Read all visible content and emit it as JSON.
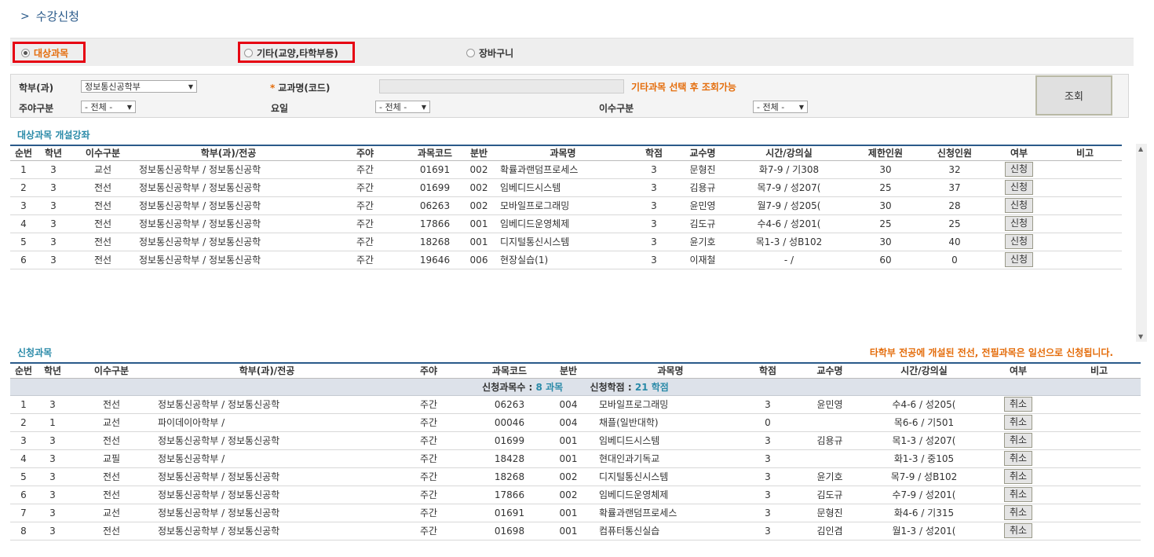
{
  "page": {
    "title": "수강신청"
  },
  "tabs": {
    "target": "대상과목",
    "other": "기타(교양,타학부등)",
    "cart": "장바구니"
  },
  "search": {
    "dept_label": "학부(과)",
    "dept_value": "정보통신공학부",
    "course_label": "교과명(코드)",
    "hint": "기타과목 선택 후 조회가능",
    "daynight_label": "주야구분",
    "daynight_value": "- 전체 -",
    "day_label": "요일",
    "day_value": "- 전체 -",
    "type_label": "이수구분",
    "type_value": "- 전체 -",
    "button": "조회"
  },
  "open_courses": {
    "title": "대상과목 개설강좌",
    "headers": [
      "순번",
      "학년",
      "이수구분",
      "학부(과)/전공",
      "주야",
      "과목코드",
      "분반",
      "과목명",
      "학점",
      "교수명",
      "시간/강의실",
      "제한인원",
      "신청인원",
      "여부",
      "비고"
    ],
    "rows": [
      [
        "1",
        "3",
        "교선",
        "정보통신공학부 / 정보통신공학",
        "주간",
        "01691",
        "002",
        "확률과랜덤프로세스",
        "3",
        "문형진",
        "화7-9 / 기308",
        "30",
        "32",
        "신청",
        ""
      ],
      [
        "2",
        "3",
        "전선",
        "정보통신공학부 / 정보통신공학",
        "주간",
        "01699",
        "002",
        "임베디드시스템",
        "3",
        "김용규",
        "목7-9 / 성207(",
        "25",
        "37",
        "신청",
        ""
      ],
      [
        "3",
        "3",
        "전선",
        "정보통신공학부 / 정보통신공학",
        "주간",
        "06263",
        "002",
        "모바일프로그래밍",
        "3",
        "윤민영",
        "월7-9 / 성205(",
        "30",
        "28",
        "신청",
        ""
      ],
      [
        "4",
        "3",
        "전선",
        "정보통신공학부 / 정보통신공학",
        "주간",
        "17866",
        "001",
        "임베디드운영체제",
        "3",
        "김도규",
        "수4-6 / 성201(",
        "25",
        "25",
        "신청",
        ""
      ],
      [
        "5",
        "3",
        "전선",
        "정보통신공학부 / 정보통신공학",
        "주간",
        "18268",
        "001",
        "디지털통신시스템",
        "3",
        "윤기호",
        "목1-3 / 성B102",
        "30",
        "40",
        "신청",
        ""
      ],
      [
        "6",
        "3",
        "전선",
        "정보통신공학부 / 정보통신공학",
        "주간",
        "19646",
        "006",
        "현장실습(1)",
        "3",
        "이재철",
        "- /",
        "60",
        "0",
        "신청",
        ""
      ]
    ]
  },
  "applied": {
    "title": "신청과목",
    "notice": "타학부 전공에 개설된 전선, 전필과목은 일선으로 신청됩니다.",
    "headers": [
      "순번",
      "학년",
      "이수구분",
      "학부(과)/전공",
      "주야",
      "과목코드",
      "분반",
      "과목명",
      "학점",
      "교수명",
      "시간/강의실",
      "여부",
      "비고"
    ],
    "summary": {
      "count_label": "신청과목수 :",
      "count_value": "8 과목",
      "credit_label": "신청학점 :",
      "credit_value": "21 학점"
    },
    "rows": [
      [
        "1",
        "3",
        "전선",
        "정보통신공학부 / 정보통신공학",
        "주간",
        "06263",
        "004",
        "모바일프로그래밍",
        "3",
        "윤민영",
        "수4-6 / 성205(",
        "취소",
        ""
      ],
      [
        "2",
        "1",
        "교선",
        "파이데이아학부 /",
        "주간",
        "00046",
        "004",
        "채플(일반대학)",
        "0",
        "",
        "목6-6 / 기501",
        "취소",
        ""
      ],
      [
        "3",
        "3",
        "전선",
        "정보통신공학부 / 정보통신공학",
        "주간",
        "01699",
        "001",
        "임베디드시스템",
        "3",
        "김용규",
        "목1-3 / 성207(",
        "취소",
        ""
      ],
      [
        "4",
        "3",
        "교필",
        "정보통신공학부 /",
        "주간",
        "18428",
        "001",
        "현대인과기독교",
        "3",
        "",
        "화1-3 / 중105",
        "취소",
        ""
      ],
      [
        "5",
        "3",
        "전선",
        "정보통신공학부 / 정보통신공학",
        "주간",
        "18268",
        "002",
        "디지털통신시스템",
        "3",
        "윤기호",
        "목7-9 / 성B102",
        "취소",
        ""
      ],
      [
        "6",
        "3",
        "전선",
        "정보통신공학부 / 정보통신공학",
        "주간",
        "17866",
        "002",
        "임베디드운영체제",
        "3",
        "김도규",
        "수7-9 / 성201(",
        "취소",
        ""
      ],
      [
        "7",
        "3",
        "교선",
        "정보통신공학부 / 정보통신공학",
        "주간",
        "01691",
        "001",
        "확률과랜덤프로세스",
        "3",
        "문형진",
        "화4-6 / 기315",
        "취소",
        ""
      ],
      [
        "8",
        "3",
        "전선",
        "정보통신공학부 / 정보통신공학",
        "주간",
        "01698",
        "001",
        "컴퓨터통신실습",
        "3",
        "김인겸",
        "월1-3 / 성201(",
        "취소",
        ""
      ]
    ]
  }
}
